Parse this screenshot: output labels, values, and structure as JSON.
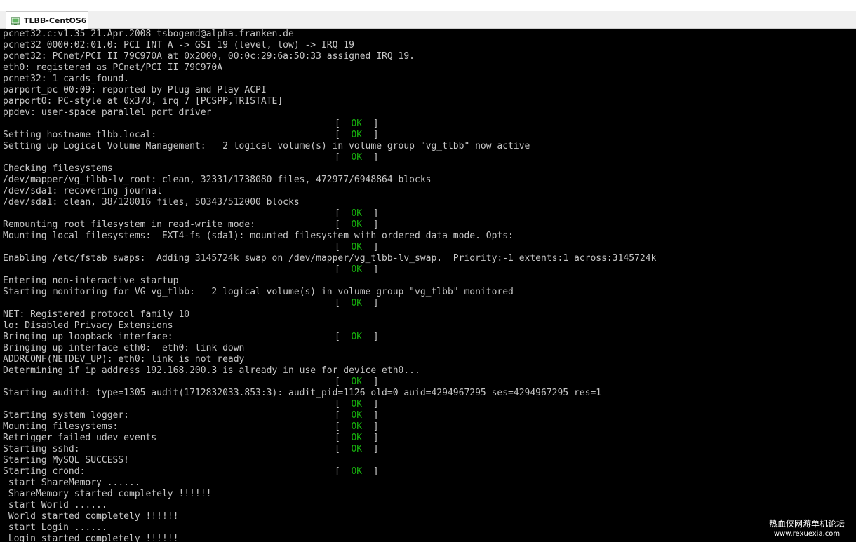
{
  "tab": {
    "title": "TLBB-CentOS6",
    "icon": "vm-console-icon"
  },
  "console": {
    "lines": [
      {
        "text": "pcnet32.c:v1.35 21.Apr.2008 tsbogend@alpha.franken.de"
      },
      {
        "text": "pcnet32 0000:02:01.0: PCI INT A -> GSI 19 (level, low) -> IRQ 19"
      },
      {
        "text": "pcnet32: PCnet/PCI II 79C970A at 0x2000, 00:0c:29:6a:50:33 assigned IRQ 19."
      },
      {
        "text": "eth0: registered as PCnet/PCI II 79C970A"
      },
      {
        "text": "pcnet32: 1 cards_found."
      },
      {
        "text": "parport_pc 00:09: reported by Plug and Play ACPI"
      },
      {
        "text": "parport0: PC-style at 0x378, irq 7 [PCSPP,TRISTATE]"
      },
      {
        "text": "ppdev: user-space parallel port driver"
      },
      {
        "text": "",
        "status": "OK"
      },
      {
        "text": "Setting hostname tlbb.local:",
        "status": "OK"
      },
      {
        "text": "Setting up Logical Volume Management:   2 logical volume(s) in volume group \"vg_tlbb\" now active"
      },
      {
        "text": "",
        "status": "OK"
      },
      {
        "text": "Checking filesystems"
      },
      {
        "text": "/dev/mapper/vg_tlbb-lv_root: clean, 32331/1738080 files, 472977/6948864 blocks"
      },
      {
        "text": "/dev/sda1: recovering journal"
      },
      {
        "text": "/dev/sda1: clean, 38/128016 files, 50343/512000 blocks"
      },
      {
        "text": "",
        "status": "OK"
      },
      {
        "text": "Remounting root filesystem in read-write mode:",
        "status": "OK"
      },
      {
        "text": "Mounting local filesystems:  EXT4-fs (sda1): mounted filesystem with ordered data mode. Opts:"
      },
      {
        "text": "",
        "status": "OK"
      },
      {
        "text": "Enabling /etc/fstab swaps:  Adding 3145724k swap on /dev/mapper/vg_tlbb-lv_swap.  Priority:-1 extents:1 across:3145724k"
      },
      {
        "text": "",
        "status": "OK"
      },
      {
        "text": "Entering non-interactive startup"
      },
      {
        "text": "Starting monitoring for VG vg_tlbb:   2 logical volume(s) in volume group \"vg_tlbb\" monitored"
      },
      {
        "text": "",
        "status": "OK"
      },
      {
        "text": "NET: Registered protocol family 10"
      },
      {
        "text": "lo: Disabled Privacy Extensions"
      },
      {
        "text": "Bringing up loopback interface:",
        "status": "OK"
      },
      {
        "text": "Bringing up interface eth0:  eth0: link down"
      },
      {
        "text": "ADDRCONF(NETDEV_UP): eth0: link is not ready"
      },
      {
        "text": "Determining if ip address 192.168.200.3 is already in use for device eth0..."
      },
      {
        "text": "",
        "status": "OK"
      },
      {
        "text": "Starting auditd: type=1305 audit(1712832033.853:3): audit_pid=1126 old=0 auid=4294967295 ses=4294967295 res=1"
      },
      {
        "text": "",
        "status": "OK"
      },
      {
        "text": "Starting system logger:",
        "status": "OK"
      },
      {
        "text": "Mounting filesystems:",
        "status": "OK"
      },
      {
        "text": "Retrigger failed udev events",
        "status": "OK"
      },
      {
        "text": "Starting sshd:",
        "status": "OK"
      },
      {
        "text": "Starting MySQL SUCCESS!"
      },
      {
        "text": "Starting crond:",
        "status": "OK"
      },
      {
        "text": " start ShareMemory ......"
      },
      {
        "text": " ShareMemory started completely !!!!!!"
      },
      {
        "text": " start World ......"
      },
      {
        "text": " World started completely !!!!!!"
      },
      {
        "text": " start Login ......"
      },
      {
        "text": " Login started completely !!!!!!"
      }
    ]
  },
  "watermark": {
    "title": "热血侠网游单机论坛",
    "url": "www.rexuexia.com"
  },
  "colors": {
    "ok": "#17b30e",
    "text": "#c6c6c6",
    "background": "#000000"
  }
}
